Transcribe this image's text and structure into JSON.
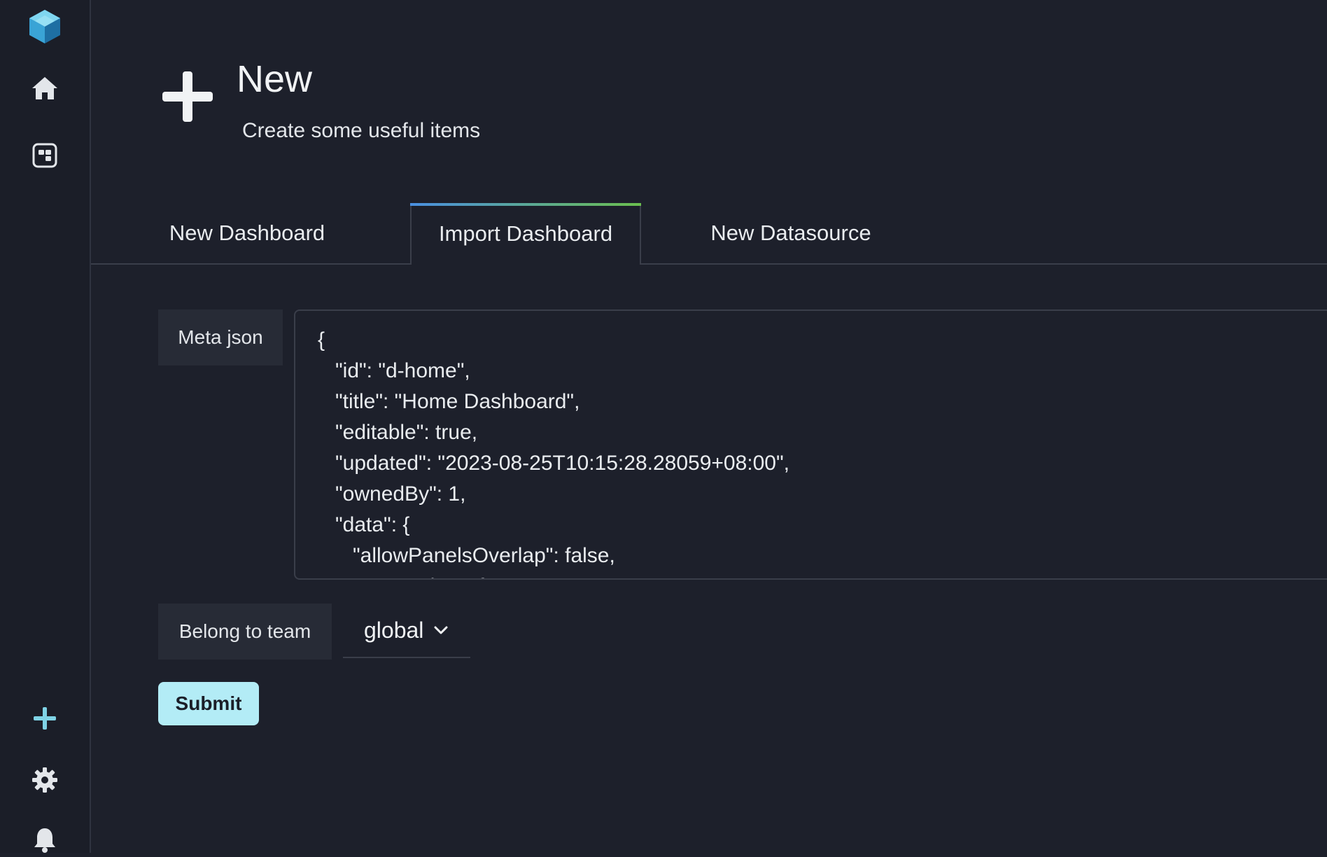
{
  "sidebar": {
    "logo": "cube-logo",
    "top_items": [
      {
        "icon": "home-icon"
      },
      {
        "icon": "dashboard-icon"
      }
    ],
    "bottom_items": [
      {
        "icon": "plus-icon"
      },
      {
        "icon": "gear-icon"
      },
      {
        "icon": "bell-icon"
      }
    ]
  },
  "header": {
    "icon": "plus-icon",
    "title": "New",
    "subtitle": "Create some useful items"
  },
  "tabs": [
    {
      "label": "New Dashboard",
      "active": false
    },
    {
      "label": "Import Dashboard",
      "active": true
    },
    {
      "label": "New Datasource",
      "active": false
    }
  ],
  "form": {
    "meta_json_label": "Meta json",
    "meta_json_value": "{\n   \"id\": \"d-home\",\n   \"title\": \"Home Dashboard\",\n   \"editable\": true,\n   \"updated\": \"2023-08-25T10:15:28.28059+08:00\",\n   \"ownedBy\": 1,\n   \"data\": {\n      \"allowPanelsOverlap\": false,\n      \"annotation\": {",
    "team_label": "Belong to team",
    "team_value": "global",
    "submit_label": "Submit"
  },
  "colors": {
    "background": "#1d202b",
    "sidebar": "#1b1e28",
    "accent": "#b3ecf6",
    "plus_icon": "#7fd3e6"
  }
}
